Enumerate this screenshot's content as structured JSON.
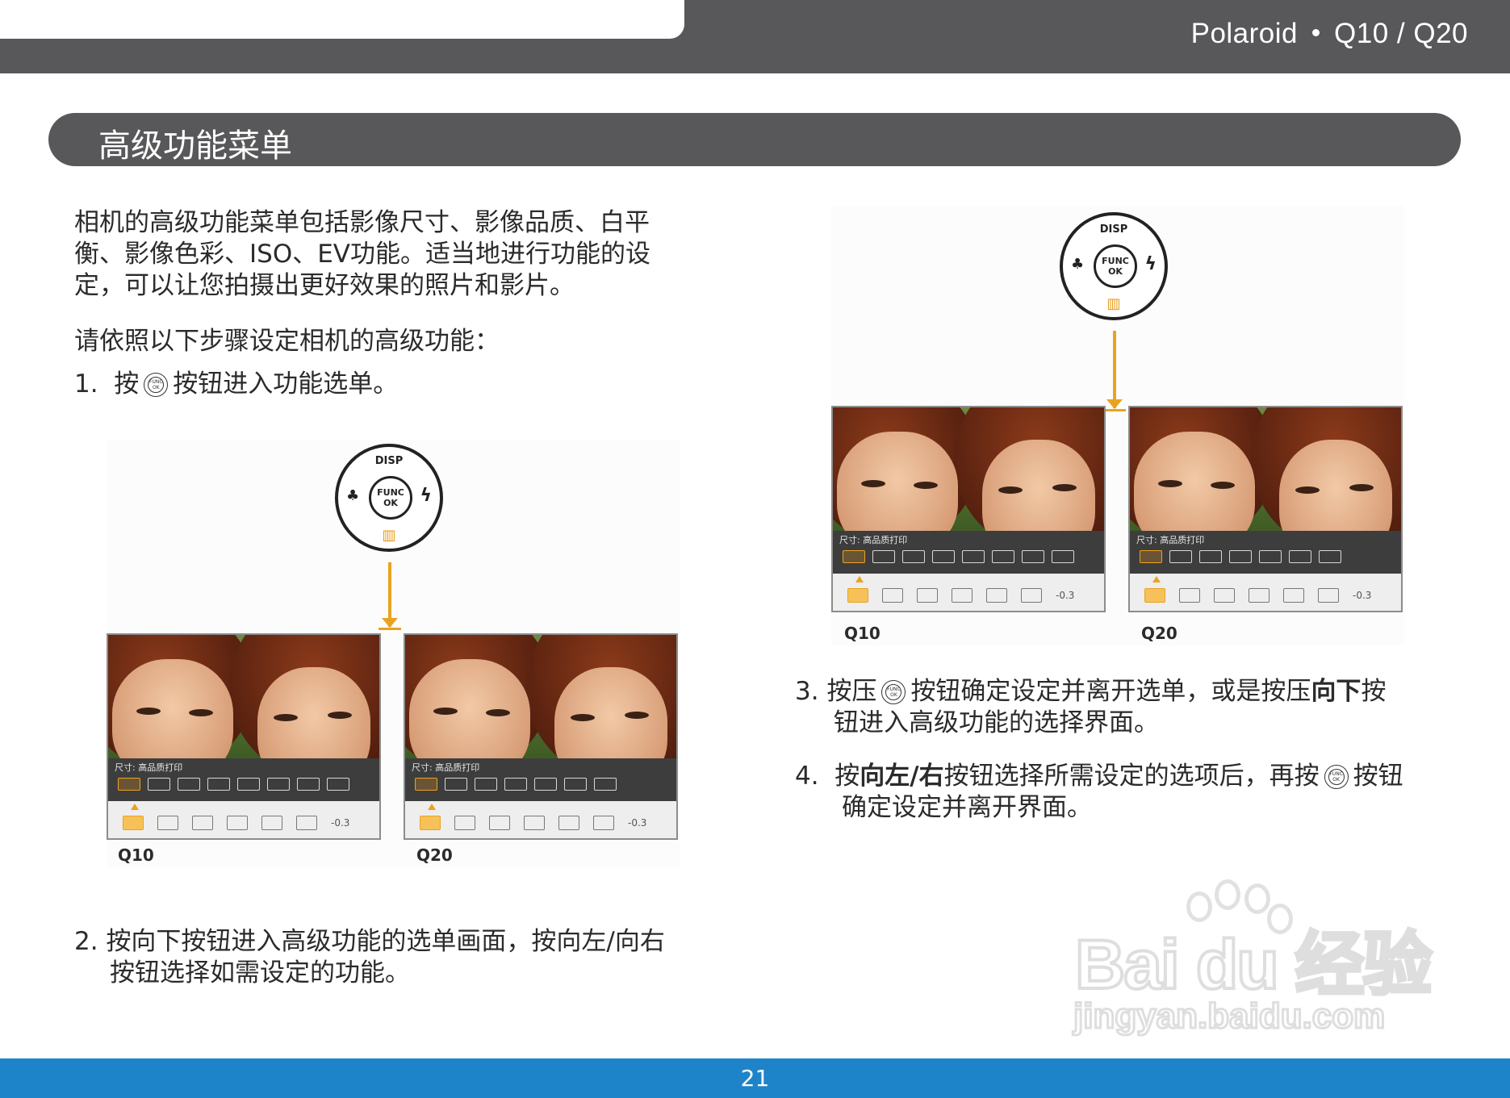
{
  "header": {
    "brand": "Polaroid",
    "model": "Q10 / Q20"
  },
  "section_title": "高级功能菜单",
  "intro": "相机的高级功能菜单包括影像尺寸、影像品质、白平衡、影像色彩、ISO、EV功能。适当地进行功能的设定，可以让您拍摄出更好效果的照片和影片。",
  "intro_lines": [
    "相机的高级功能菜单包括影像尺寸、影像品质、白平",
    "衡、影像色彩、ISO、EV功能。适当地进行功能的设",
    "定，可以让您拍摄出更好效果的照片和影片。"
  ],
  "steps_intro": "请依照以下步骤设定相机的高级功能：",
  "step1": {
    "num": "1.",
    "pre": "按",
    "post": "按钮进入功能选单。"
  },
  "step2": {
    "num": "2.",
    "line1": "按向下按钮进入高级功能的选单画面，按向左/向右",
    "line2": "按钮选择如需设定的功能。"
  },
  "step3": {
    "num": "3.",
    "pre": "按压",
    "mid": "按钮确定设定并离开选单，或是按压",
    "bold": "向下",
    "post": "按",
    "line2": "钮进入高级功能的选择界面。"
  },
  "step4": {
    "num": "4.",
    "pre": "按",
    "bold": "向左/右",
    "mid": "按钮选择所需设定的选项后，再按",
    "post": "按钮",
    "line2": "确定设定并离开界面。"
  },
  "dial": {
    "top": "DISP",
    "center_line1": "FUNC",
    "center_line2": "OK",
    "left": "♣",
    "right": "ϟ",
    "bottom": "▥"
  },
  "screens": {
    "menu_title": "尺寸: 高品质打印",
    "ev_value": "-0.3",
    "captions": [
      "Q10",
      "Q20"
    ]
  },
  "watermark": {
    "main": "Bai du 经验",
    "sub": "jingyan.baidu.com"
  },
  "page_number": "21",
  "colors": {
    "header_gray": "#58585a",
    "footer_blue": "#1e84c9",
    "accent_orange": "#e8a321"
  }
}
